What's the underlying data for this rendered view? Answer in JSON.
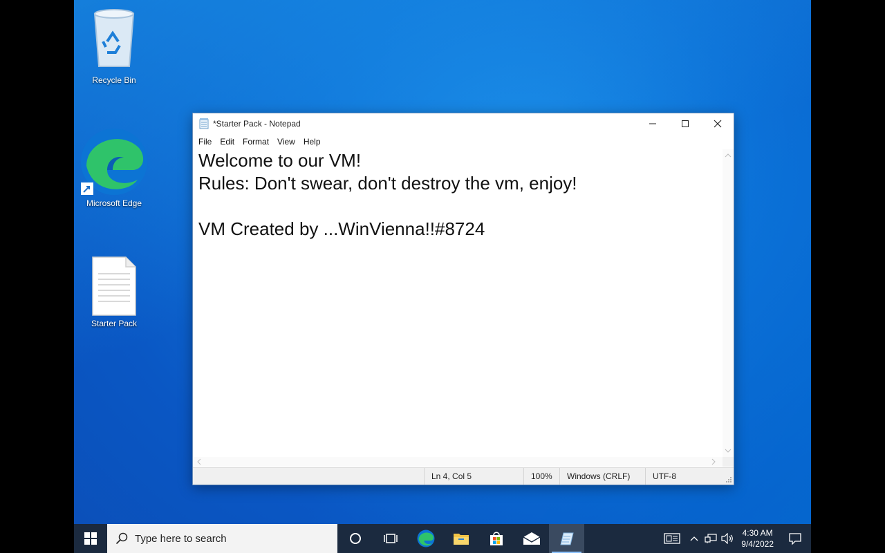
{
  "desktop": {
    "icons": [
      {
        "label": "Recycle Bin",
        "icon": "recycle-bin-icon"
      },
      {
        "label": "Microsoft Edge",
        "icon": "edge-icon"
      },
      {
        "label": "Starter Pack",
        "icon": "text-file-icon"
      }
    ]
  },
  "notepad": {
    "title": "*Starter Pack - Notepad",
    "menu": [
      "File",
      "Edit",
      "Format",
      "View",
      "Help"
    ],
    "lines": [
      "Welcome to our VM!",
      "Rules: Don't swear, don't destroy the vm, enjoy!",
      "",
      "VM Created by ...WinVienna!!#8724"
    ],
    "status": {
      "position": "Ln 4, Col 5",
      "zoom": "100%",
      "line_ending": "Windows (CRLF)",
      "encoding": "UTF-8"
    }
  },
  "taskbar": {
    "search_placeholder": "Type here to search",
    "apps": [
      "cortana-icon",
      "task-view-icon",
      "edge-icon",
      "file-explorer-icon",
      "store-icon",
      "mail-icon",
      "notepad-icon"
    ],
    "time": "4:30 AM",
    "date": "9/4/2022"
  },
  "colors": {
    "desktop": "#0f6fd6",
    "taskbar": "#1b2a3f"
  }
}
